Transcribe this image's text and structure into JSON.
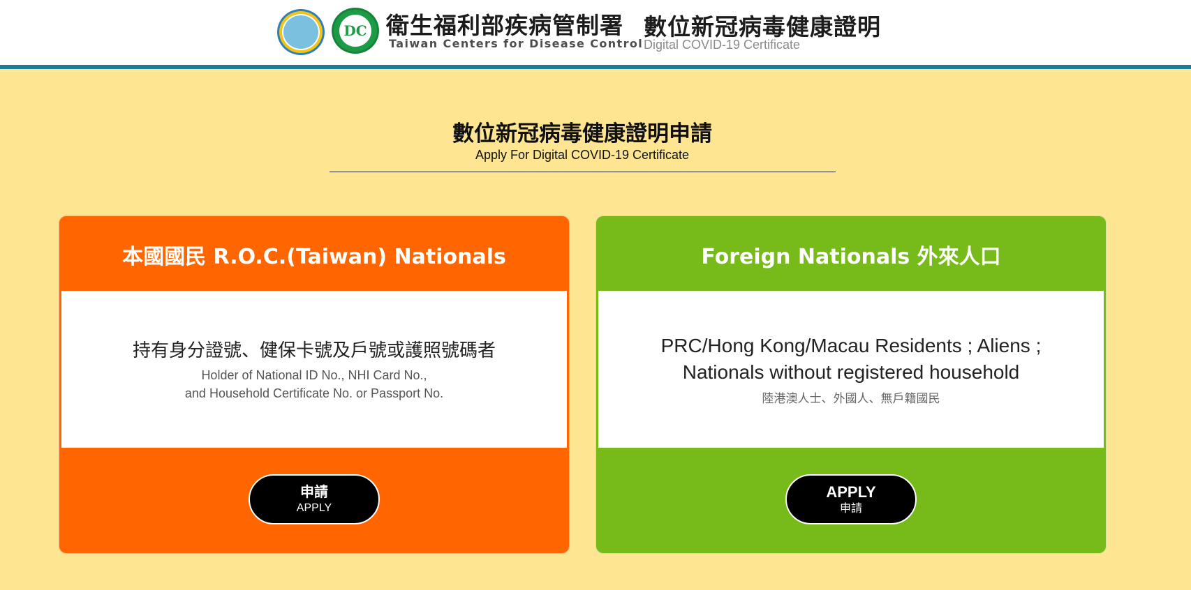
{
  "header": {
    "agency_zh": "衛生福利部疾病管制署",
    "agency_en": "Taiwan Centers for Disease Control",
    "site_title_zh": "數位新冠病毒健康證明",
    "site_title_en": "Digital COVID-19 Certificate",
    "mohw_logo_icon": "mohw-emblem-icon",
    "cdc_logo_icon": "taiwan-cdc-logo-icon",
    "cdc_logo_glyph": "DC",
    "accent_color": "#1f7a93"
  },
  "main": {
    "title_zh": "數位新冠病毒健康證明申請",
    "title_en": "Apply For Digital COVID-19 Certificate",
    "background_color": "#fee591"
  },
  "cards": [
    {
      "heading": "本國國民 R.O.C.(Taiwan) Nationals",
      "color": "#ff6600",
      "description_main": "持有身分證號、健保卡號及戶號或護照號碼者",
      "description_sub_line1": "Holder of National ID No., NHI Card No.,",
      "description_sub_line2": "and Household Certificate No. or Passport No.",
      "button_line1": "申請",
      "button_line2": "APPLY"
    },
    {
      "heading": "Foreign Nationals 外來人口",
      "color": "#76bb1a",
      "description_main_line1": "PRC/Hong Kong/Macau Residents ; Aliens ;",
      "description_main_line2": "Nationals without registered household",
      "description_sub": "陸港澳人士、外國人、無戶籍國民",
      "button_line1": "APPLY",
      "button_line2": "申請"
    }
  ]
}
